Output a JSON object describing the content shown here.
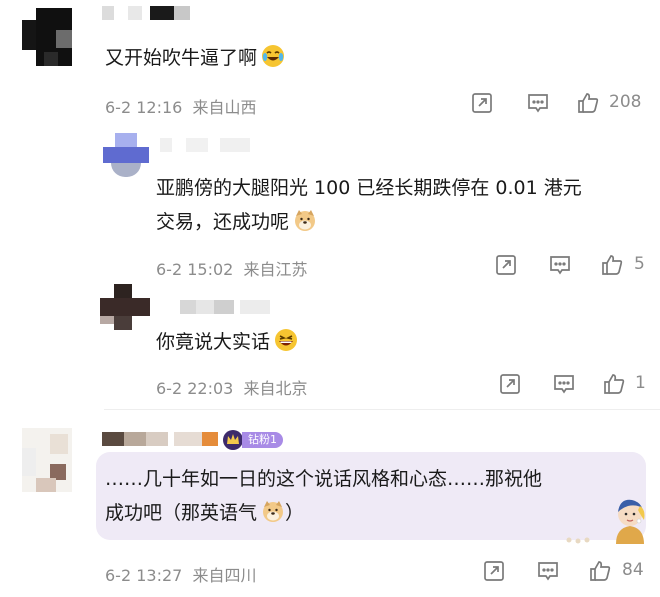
{
  "comments": [
    {
      "id": "c1",
      "text": "又开始吹牛逼了啊",
      "emoji_name": "laugh-cry-emoji",
      "time": "6-2 12:16",
      "location": "来自山西",
      "likes": "208"
    },
    {
      "id": "c2",
      "line1": "亚鹏傍的大腿阳光 100 已经长期跌停在 0.01 港元",
      "line2": "交易，还成功呢",
      "emoji_name": "doge-emoji",
      "time": "6-2 15:02",
      "location": "来自江苏",
      "likes": "5"
    },
    {
      "id": "c3",
      "text": "你竟说大实话",
      "emoji_name": "grin-emoji",
      "time": "6-2 22:03",
      "location": "来自北京",
      "likes": "1"
    },
    {
      "id": "c4",
      "badge": "钻粉1",
      "line1": "……几十年如一日的这个说话风格和心态……那祝他",
      "line2": "成功吧（那英语气",
      "line2_end": "）",
      "emoji_name": "doge-emoji",
      "time": "6-2 13:27",
      "location": "来自四川",
      "likes": "84"
    }
  ],
  "icons": {
    "share": "share-icon",
    "comment": "comment-icon",
    "like": "thumbs-up-icon"
  },
  "colors": {
    "text": "#1a1a1a",
    "meta": "#8c8c8c",
    "badge_bg": "#a88be6",
    "card_bg": "#efeaf6"
  }
}
